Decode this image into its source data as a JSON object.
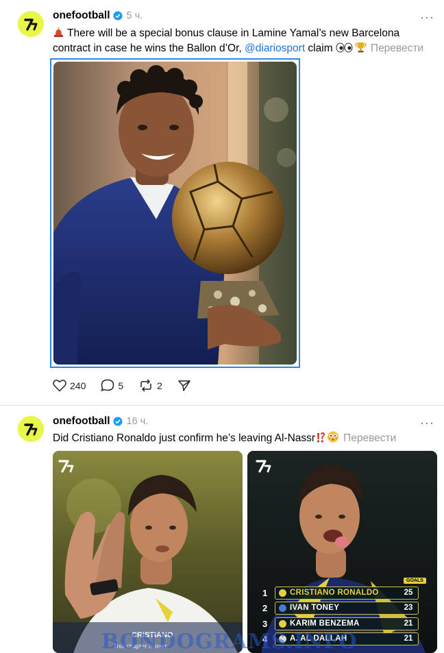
{
  "posts": [
    {
      "username": "onefootball",
      "time": "5 ч.",
      "text_pre": " There will be a special bonus clause in Lamine Yamal’s new Barcelona contract in case he wins the Ballon d’Or, ",
      "mention": "@diariosport",
      "text_post": " claim ",
      "translate": "Перевести",
      "actions": {
        "likes": "240",
        "comments": "5",
        "reposts": "2"
      }
    },
    {
      "username": "onefootball",
      "time": "16 ч.",
      "text": "Did Cristiano Ronaldo just confirm he’s leaving Al-Nassr",
      "translate": "Перевести",
      "left_card_caption": "CRISTIANO",
      "left_card_subcaption": "This chapter is over.",
      "ranking": {
        "header": "GOALS",
        "rows": [
          {
            "rank": "1",
            "name": "CRISTIANO RONALDO",
            "goals": "25"
          },
          {
            "rank": "2",
            "name": "IVAN TONEY",
            "goals": "23"
          },
          {
            "rank": "3",
            "name": "KARIM BENZEMA",
            "goals": "21"
          },
          {
            "rank": "4",
            "name": "A. AL DALLAH",
            "goals": "21"
          }
        ]
      }
    }
  ],
  "watermark": "BONDOGRAMS.INFO",
  "colors": {
    "link": "#1d74d8",
    "avatar": "#e8f84a",
    "verified": "#1d9bf0",
    "selection": "#2f86e4"
  }
}
